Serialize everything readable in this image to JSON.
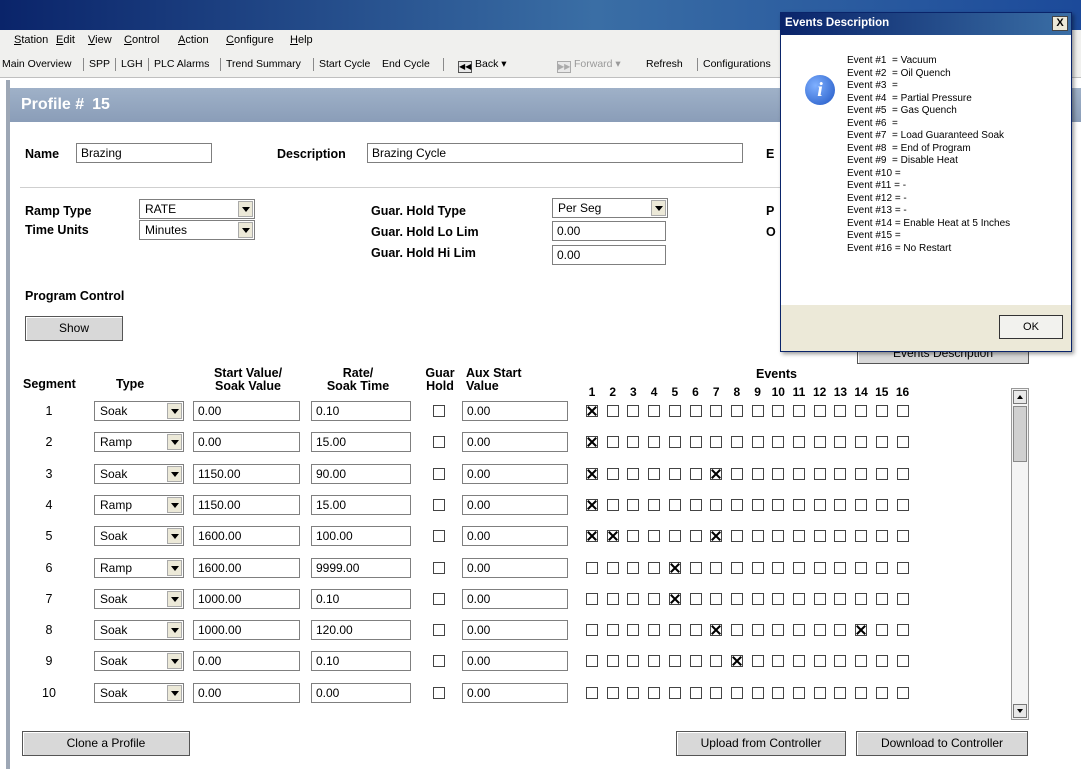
{
  "menu": [
    "Station",
    "Edit",
    "View",
    "Control",
    "Action",
    "Configure",
    "Help"
  ],
  "toolbar": {
    "items": [
      "Main Overview",
      "SPP",
      "LGH",
      "PLC Alarms",
      "Trend Summary",
      "Start Cycle",
      "End Cycle"
    ],
    "back": "Back",
    "forward": "Forward",
    "refresh": "Refresh",
    "configurations": "Configurations"
  },
  "profile": {
    "title": "Profile #",
    "number": "15"
  },
  "form": {
    "name_label": "Name",
    "name_value": "Brazing",
    "description_label": "Description",
    "description_value": "Brazing Cycle",
    "cut_label_e": "E",
    "cut_label_p": "P",
    "cut_label_o": "O",
    "ramp_type_label": "Ramp Type",
    "ramp_type_value": "RATE",
    "time_units_label": "Time Units",
    "time_units_value": "Minutes",
    "guar_hold_type_label": "Guar. Hold Type",
    "guar_hold_type_value": "Per Seg",
    "guar_hold_lo_label": "Guar. Hold Lo Lim",
    "guar_hold_lo_value": "0.00",
    "guar_hold_hi_label": "Guar. Hold Hi Lim",
    "guar_hold_hi_value": "0.00",
    "program_control_label": "Program Control",
    "show_button": "Show",
    "events_description_button": "Events Description"
  },
  "table": {
    "headers": {
      "segment": "Segment",
      "type": "Type",
      "start_value": "Start Value/",
      "soak_value": "Soak Value",
      "rate": "Rate/",
      "soak_time": "Soak Time",
      "guar": "Guar",
      "hold": "Hold",
      "aux_start": "Aux Start",
      "aux_value": "Value",
      "events": "Events"
    },
    "event_numbers": [
      "1",
      "2",
      "3",
      "4",
      "5",
      "6",
      "7",
      "8",
      "9",
      "10",
      "11",
      "12",
      "13",
      "14",
      "15",
      "16"
    ],
    "rows": [
      {
        "segment": "1",
        "type": "Soak",
        "start": "0.00",
        "rate": "0.10",
        "guar_hold": false,
        "aux": "0.00",
        "events": [
          1
        ]
      },
      {
        "segment": "2",
        "type": "Ramp",
        "start": "0.00",
        "rate": "15.00",
        "guar_hold": false,
        "aux": "0.00",
        "events": [
          1
        ]
      },
      {
        "segment": "3",
        "type": "Soak",
        "start": "1150.00",
        "rate": "90.00",
        "guar_hold": false,
        "aux": "0.00",
        "events": [
          1,
          7
        ]
      },
      {
        "segment": "4",
        "type": "Ramp",
        "start": "1150.00",
        "rate": "15.00",
        "guar_hold": false,
        "aux": "0.00",
        "events": [
          1
        ]
      },
      {
        "segment": "5",
        "type": "Soak",
        "start": "1600.00",
        "rate": "100.00",
        "guar_hold": false,
        "aux": "0.00",
        "events": [
          1,
          2,
          7
        ]
      },
      {
        "segment": "6",
        "type": "Ramp",
        "start": "1600.00",
        "rate": "9999.00",
        "guar_hold": false,
        "aux": "0.00",
        "events": [
          5
        ]
      },
      {
        "segment": "7",
        "type": "Soak",
        "start": "1000.00",
        "rate": "0.10",
        "guar_hold": false,
        "aux": "0.00",
        "events": [
          5
        ]
      },
      {
        "segment": "8",
        "type": "Soak",
        "start": "1000.00",
        "rate": "120.00",
        "guar_hold": false,
        "aux": "0.00",
        "events": [
          7,
          14
        ]
      },
      {
        "segment": "9",
        "type": "Soak",
        "start": "0.00",
        "rate": "0.10",
        "guar_hold": false,
        "aux": "0.00",
        "events": [
          8
        ]
      },
      {
        "segment": "10",
        "type": "Soak",
        "start": "0.00",
        "rate": "0.00",
        "guar_hold": false,
        "aux": "0.00",
        "events": []
      }
    ]
  },
  "buttons": {
    "clone": "Clone a Profile",
    "upload": "Upload from Controller",
    "download": "Download to Controller"
  },
  "dialog": {
    "title": "Events Description",
    "close": "X",
    "icon": "info-icon",
    "lines": [
      "Event #1  = Vacuum",
      "Event #2  = Oil Quench",
      "Event #3  =",
      "Event #4  = Partial Pressure",
      "Event #5  = Gas Quench",
      "Event #6  =",
      "Event #7  = Load Guaranteed Soak",
      "Event #8  = End of Program",
      "Event #9  = Disable Heat",
      "Event #10 =",
      "Event #11 = -",
      "Event #12 = -",
      "Event #13 = -",
      "Event #14 = Enable Heat at 5 Inches",
      "Event #15 =",
      "Event #16 = No Restart"
    ],
    "ok": "OK"
  },
  "colors": {
    "titlebar": "#0a246a",
    "profile_header": "#8a9db8",
    "window_bg": "#ece9d8"
  }
}
